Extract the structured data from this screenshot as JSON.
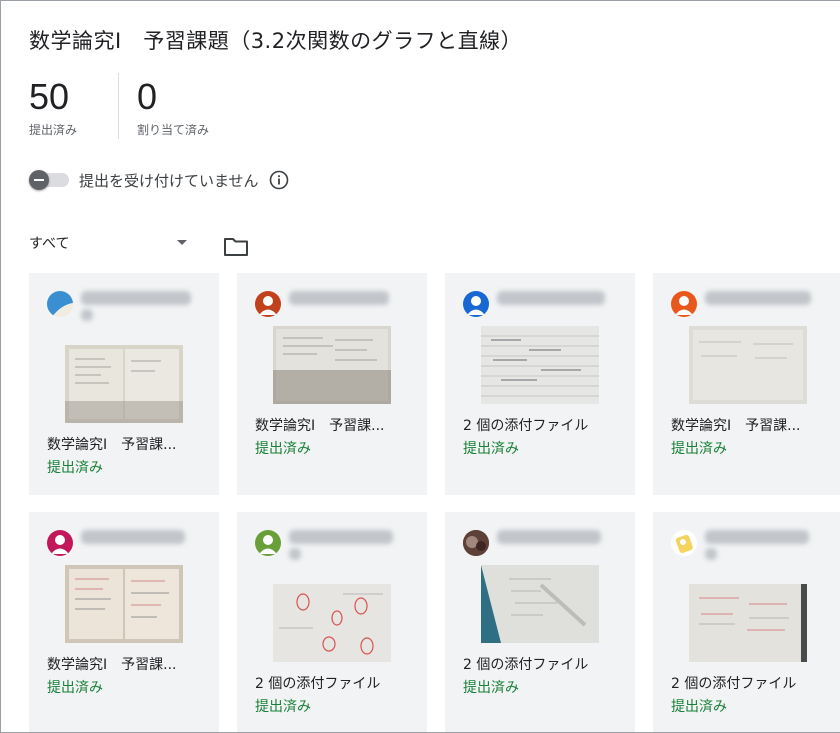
{
  "title": "数学論究Ⅰ　予習課題（3.2次関数のグラフと直線）",
  "stats": {
    "submitted": {
      "value": "50",
      "label": "提出済み"
    },
    "assigned": {
      "value": "0",
      "label": "割り当て済み"
    }
  },
  "toggle": {
    "label": "提出を受け付けていません",
    "on": false
  },
  "filter": {
    "selected": "すべて"
  },
  "icons": {
    "info": "info-icon",
    "folder": "folder-icon",
    "caret": "chevron-down-icon"
  },
  "colors": {
    "status_green": "#188038",
    "card_bg": "#f1f3f4"
  },
  "cards": [
    {
      "attachment": "数学論究Ⅰ　予習課...",
      "status": "提出済み"
    },
    {
      "attachment": "数学論究Ⅰ　予習課...",
      "status": "提出済み"
    },
    {
      "attachment": "2 個の添付ファイル",
      "status": "提出済み"
    },
    {
      "attachment": "数学論究Ⅰ　予習課...",
      "status": "提出済み"
    },
    {
      "attachment": "数学論究Ⅰ　予習課...",
      "status": "提出済み"
    },
    {
      "attachment": "2 個の添付ファイル",
      "status": "提出済み"
    },
    {
      "attachment": "2 個の添付ファイル",
      "status": "提出済み"
    },
    {
      "attachment": "2 個の添付ファイル",
      "status": "提出済み"
    }
  ]
}
